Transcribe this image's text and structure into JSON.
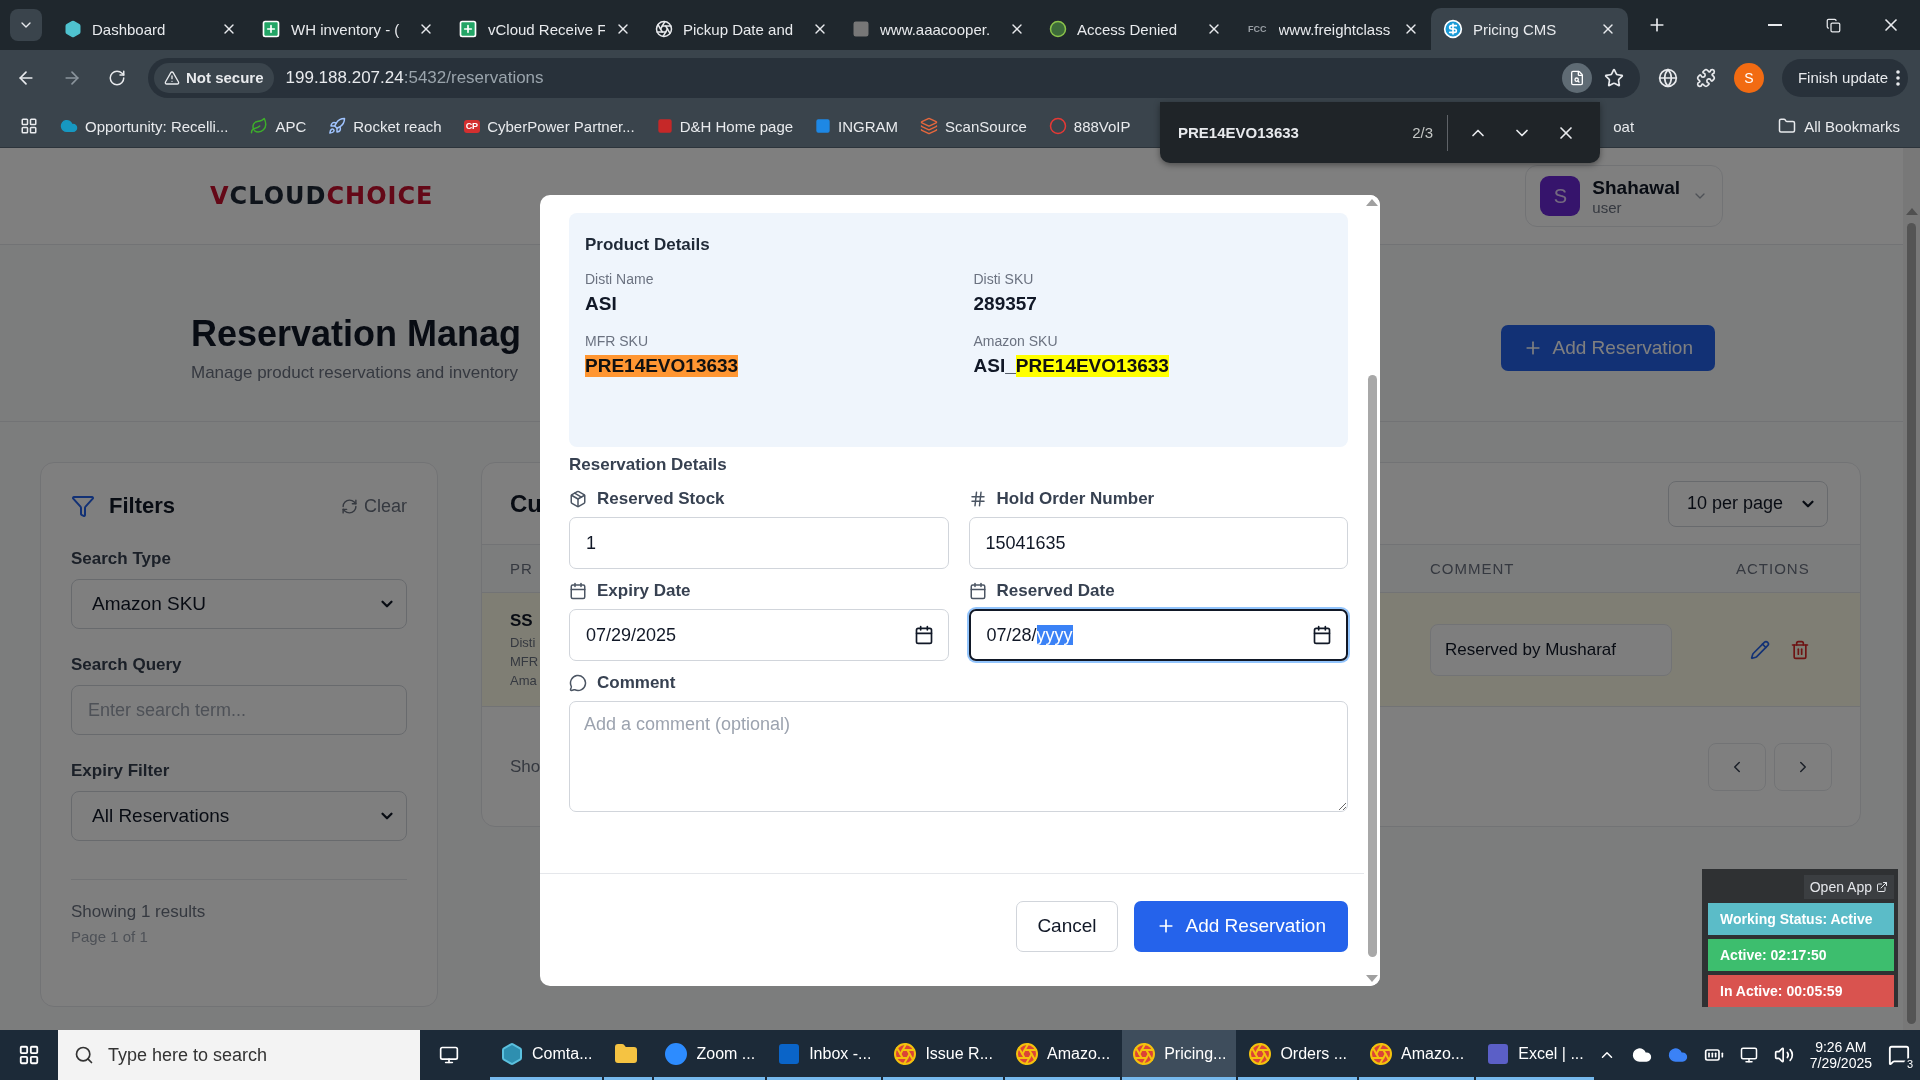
{
  "browser": {
    "tabs": [
      {
        "title": "Dashboard",
        "selected": false
      },
      {
        "title": "WH inventory - (",
        "selected": false
      },
      {
        "title": "vCloud Receive F",
        "selected": false
      },
      {
        "title": "Pickup Date and",
        "selected": false
      },
      {
        "title": "www.aaacooper.",
        "selected": false
      },
      {
        "title": "Access Denied",
        "selected": false
      },
      {
        "title": "www.freightclass",
        "icon_text": "FCC",
        "selected": false
      },
      {
        "title": "Pricing CMS",
        "selected": true
      }
    ],
    "security": "Not secure",
    "url": {
      "host": "199.188.207.24",
      "path": ":5432/reservations"
    },
    "profile_initial": "S",
    "update_button": "Finish update",
    "bookmarks": [
      {
        "label": "Opportunity: Recelli..."
      },
      {
        "label": "APC"
      },
      {
        "label": "Rocket reach"
      },
      {
        "label": "CyberPower Partner...",
        "icon_text": "CP"
      },
      {
        "label": "D&H Home page"
      },
      {
        "label": "INGRAM"
      },
      {
        "label": "ScanSource"
      },
      {
        "label": "888VoIP"
      }
    ],
    "bookmark_partial": "oat",
    "all_bookmarks": "All Bookmarks"
  },
  "find_bar": {
    "query": "PRE14EVO13633",
    "count": "2/3"
  },
  "page": {
    "logo": {
      "initial": "V",
      "first": "CLOUD",
      "second": "CHOICE"
    },
    "user": {
      "initial": "S",
      "name": "Shahawal",
      "role": "user"
    },
    "title": "Reservation Manag",
    "subtitle": "Manage product reservations and inventory",
    "add_button": "Add Reservation",
    "filters": {
      "title": "Filters",
      "clear": "Clear",
      "fields": [
        {
          "label": "Search Type",
          "kind": "select",
          "value": "Amazon SKU"
        },
        {
          "label": "Search Query",
          "kind": "text",
          "placeholder": "Enter search term..."
        },
        {
          "label": "Expiry Filter",
          "kind": "select",
          "value": "All Reservations"
        }
      ],
      "summary": "Showing 1 results",
      "page_info": "Page 1 of 1"
    },
    "reservations": {
      "title": "Cu",
      "per_page": "10 per page",
      "columns": [
        "PR",
        "COMMENT",
        "ACTIONS"
      ],
      "rows": [
        {
          "product": "SS",
          "details": [
            "Disti",
            "MFR",
            "Ama"
          ],
          "comment": "Reserved by Musharaf"
        }
      ],
      "footer": "Sho"
    }
  },
  "modal": {
    "product_details": {
      "title": "Product Details",
      "fields": [
        {
          "label": "Disti Name",
          "value": "ASI"
        },
        {
          "label": "Disti SKU",
          "value": "289357"
        },
        {
          "label": "MFR SKU",
          "match": "PRE14EVO13633",
          "current_match": true
        },
        {
          "label": "Amazon SKU",
          "value": "ASI_",
          "match": "PRE14EVO13633",
          "current_match": false
        }
      ]
    },
    "reservation_details": {
      "title": "Reservation Details",
      "fields": [
        {
          "label": "Reserved Stock",
          "kind": "text",
          "value": "1"
        },
        {
          "label": "Hold Order Number",
          "kind": "text",
          "value": "15041635"
        },
        {
          "label": "Expiry Date",
          "kind": "date",
          "value": "07/29/2025",
          "focused": false
        },
        {
          "label": "Reserved Date",
          "kind": "date",
          "value": "07/28/",
          "selected_segment": "yyyy",
          "focused": true
        },
        {
          "label": "Comment",
          "kind": "textarea",
          "placeholder": "Add a comment (optional)"
        }
      ]
    },
    "cancel": "Cancel",
    "submit": "Add Reservation"
  },
  "status_widget": {
    "open_app": "Open App",
    "rows": [
      {
        "text": "Working Status: Active",
        "color": "#5bbcc8"
      },
      {
        "text": "Active: 02:17:50",
        "color": "#3dbe6e"
      },
      {
        "text": "In Active: 00:05:59",
        "color": "#d9534f"
      }
    ]
  },
  "taskbar": {
    "search_placeholder": "Type here to search",
    "apps": [
      {
        "label": "Comta...",
        "selected": false
      },
      {
        "selected": false
      },
      {
        "label": "Zoom ...",
        "selected": false
      },
      {
        "label": "Inbox -...",
        "selected": false
      },
      {
        "label": "Issue R...",
        "selected": false
      },
      {
        "label": "Amazo...",
        "selected": false
      },
      {
        "label": "Pricing...",
        "selected": true
      },
      {
        "label": "Orders ...",
        "selected": false
      },
      {
        "label": "Amazo...",
        "selected": false
      },
      {
        "label": "Excel | ...",
        "selected": false
      }
    ],
    "time": "9:26 AM",
    "date": "7/29/2025",
    "notifications": "3"
  }
}
